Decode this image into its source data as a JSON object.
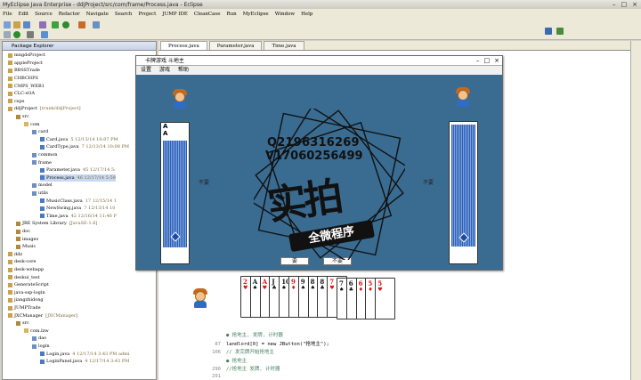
{
  "ide": {
    "title": "MyEclipse Java Enterprise - ddjProject/src/com/frame/Process.java - Eclipse",
    "menu": [
      "File",
      "Edit",
      "Source",
      "Refactor",
      "Navigate",
      "Search",
      "Project",
      "JUMP IDE",
      "CleanCase",
      "Run",
      "MyEclipse",
      "Window",
      "Help"
    ],
    "explorer_tab": "Package Explorer",
    "tree": [
      {
        "indent": 0,
        "label": "mngdsProject",
        "extra": ""
      },
      {
        "indent": 0,
        "label": "appleProject",
        "extra": ""
      },
      {
        "indent": 0,
        "label": "BBSSTrade",
        "extra": ""
      },
      {
        "indent": 0,
        "label": "CHBCHPS",
        "extra": ""
      },
      {
        "indent": 0,
        "label": "CMPS_WEB1",
        "extra": ""
      },
      {
        "indent": 0,
        "label": "CLC-sOA",
        "extra": ""
      },
      {
        "indent": 0,
        "label": "cxps",
        "extra": ""
      },
      {
        "indent": 0,
        "label": "ddjProject",
        "extra": "[trunk/ddjProject]"
      },
      {
        "indent": 1,
        "label": "src",
        "extra": ""
      },
      {
        "indent": 2,
        "label": "com",
        "extra": ""
      },
      {
        "indent": 3,
        "label": "card",
        "extra": ""
      },
      {
        "indent": 4,
        "label": "Card.java",
        "extra": "5  12/13/14 10:07 PM"
      },
      {
        "indent": 4,
        "label": "CardType.java",
        "extra": "7  12/13/14 10:08 PM"
      },
      {
        "indent": 3,
        "label": "common",
        "extra": ""
      },
      {
        "indent": 3,
        "label": "frame",
        "extra": ""
      },
      {
        "indent": 4,
        "label": "Parameter.java",
        "extra": "45  12/17/14 5:"
      },
      {
        "indent": 4,
        "label": "Process.java",
        "extra": "46  12/17/14 5:59"
      },
      {
        "indent": 3,
        "label": "model",
        "extra": ""
      },
      {
        "indent": 3,
        "label": "utils",
        "extra": ""
      },
      {
        "indent": 4,
        "label": "MusicClass.java",
        "extra": "17  12/15/14 1"
      },
      {
        "indent": 4,
        "label": "NewSwing.java",
        "extra": "7  12/13/14 10"
      },
      {
        "indent": 4,
        "label": "Time.java",
        "extra": "42  12/16/14 11:46 P"
      },
      {
        "indent": 1,
        "label": "JRE System Library",
        "extra": "[JavaSE-1.6]"
      },
      {
        "indent": 1,
        "label": "doc",
        "extra": ""
      },
      {
        "indent": 1,
        "label": "images",
        "extra": ""
      },
      {
        "indent": 1,
        "label": "Music",
        "extra": ""
      },
      {
        "indent": 0,
        "label": "ddz",
        "extra": ""
      },
      {
        "indent": 0,
        "label": "desk-core",
        "extra": ""
      },
      {
        "indent": 0,
        "label": "desk-webapp",
        "extra": ""
      },
      {
        "indent": 0,
        "label": "deskui_test",
        "extra": ""
      },
      {
        "indent": 0,
        "label": "GenerateScript",
        "extra": ""
      },
      {
        "indent": 0,
        "label": "java-ssp-login",
        "extra": ""
      },
      {
        "indent": 0,
        "label": "jiangzhidong",
        "extra": ""
      },
      {
        "indent": 0,
        "label": "JUMPTrade",
        "extra": ""
      },
      {
        "indent": 0,
        "label": "JXCManager",
        "extra": "[JXCManager]"
      },
      {
        "indent": 1,
        "label": "src",
        "extra": ""
      },
      {
        "indent": 2,
        "label": "com.lzw",
        "extra": ""
      },
      {
        "indent": 3,
        "label": "dao",
        "extra": ""
      },
      {
        "indent": 3,
        "label": "login",
        "extra": ""
      },
      {
        "indent": 4,
        "label": "Login.java",
        "extra": "4  12/17/14 3:43 PM  admi"
      },
      {
        "indent": 4,
        "label": "LoginPanel.java",
        "extra": "4  12/17/14 3:43 PM"
      }
    ],
    "editor_tabs": [
      {
        "label": "Process.java",
        "active": true
      },
      {
        "label": "Parameter.java",
        "active": false
      },
      {
        "label": "Time.java",
        "active": false
      }
    ],
    "code_lines": [
      {
        "num": "",
        "text": "● 抢地主, 发牌, 计时器",
        "type": "cm"
      },
      {
        "num": "87",
        "text": "landlord[0] = new JButton(\"抢地主\");",
        "type": "code"
      },
      {
        "num": "106",
        "text": "// 发完牌开始抢地主",
        "type": "cm"
      },
      {
        "num": "",
        "text": "● 抢地主",
        "type": "cm"
      },
      {
        "num": "290",
        "text": "//抢地主 发牌, 计时器",
        "type": "cm"
      },
      {
        "num": "291",
        "text": "",
        "type": "code"
      }
    ]
  },
  "game": {
    "title": "卡牌游戏 斗地主",
    "menu": [
      "设置",
      "游戏",
      "帮助"
    ],
    "left_top_card": "A",
    "left_pass": "不要",
    "right_pass": "不要",
    "btn_left": "要",
    "btn_right": "不要",
    "player_cards": [
      {
        "rank": "2",
        "suit": "♥",
        "color": "red"
      },
      {
        "rank": "A",
        "suit": "♠",
        "color": "blk"
      },
      {
        "rank": "A",
        "suit": "♥",
        "color": "red"
      },
      {
        "rank": "J",
        "suit": "♣",
        "color": "blk"
      },
      {
        "rank": "10",
        "suit": "♠",
        "color": "blk"
      },
      {
        "rank": "9",
        "suit": "♦",
        "color": "red"
      },
      {
        "rank": "9",
        "suit": "♠",
        "color": "blk"
      },
      {
        "rank": "8",
        "suit": "♠",
        "color": "blk"
      },
      {
        "rank": "8",
        "suit": "♣",
        "color": "blk"
      },
      {
        "rank": "7",
        "suit": "♥",
        "color": "red"
      },
      {
        "rank": "7",
        "suit": "♠",
        "color": "blk"
      },
      {
        "rank": "6",
        "suit": "♣",
        "color": "blk"
      },
      {
        "rank": "6",
        "suit": "♦",
        "color": "red"
      },
      {
        "rank": "5",
        "suit": "♦",
        "color": "red"
      },
      {
        "rank": "5",
        "suit": "♥",
        "color": "red"
      }
    ]
  },
  "watermark": {
    "qq": "Q2196316269",
    "vx": "V17060256499",
    "big": "实拍",
    "banner": "全微程序"
  },
  "colors": {
    "game_bg": "#3a6c92",
    "card_back": "#2b5fb5"
  }
}
